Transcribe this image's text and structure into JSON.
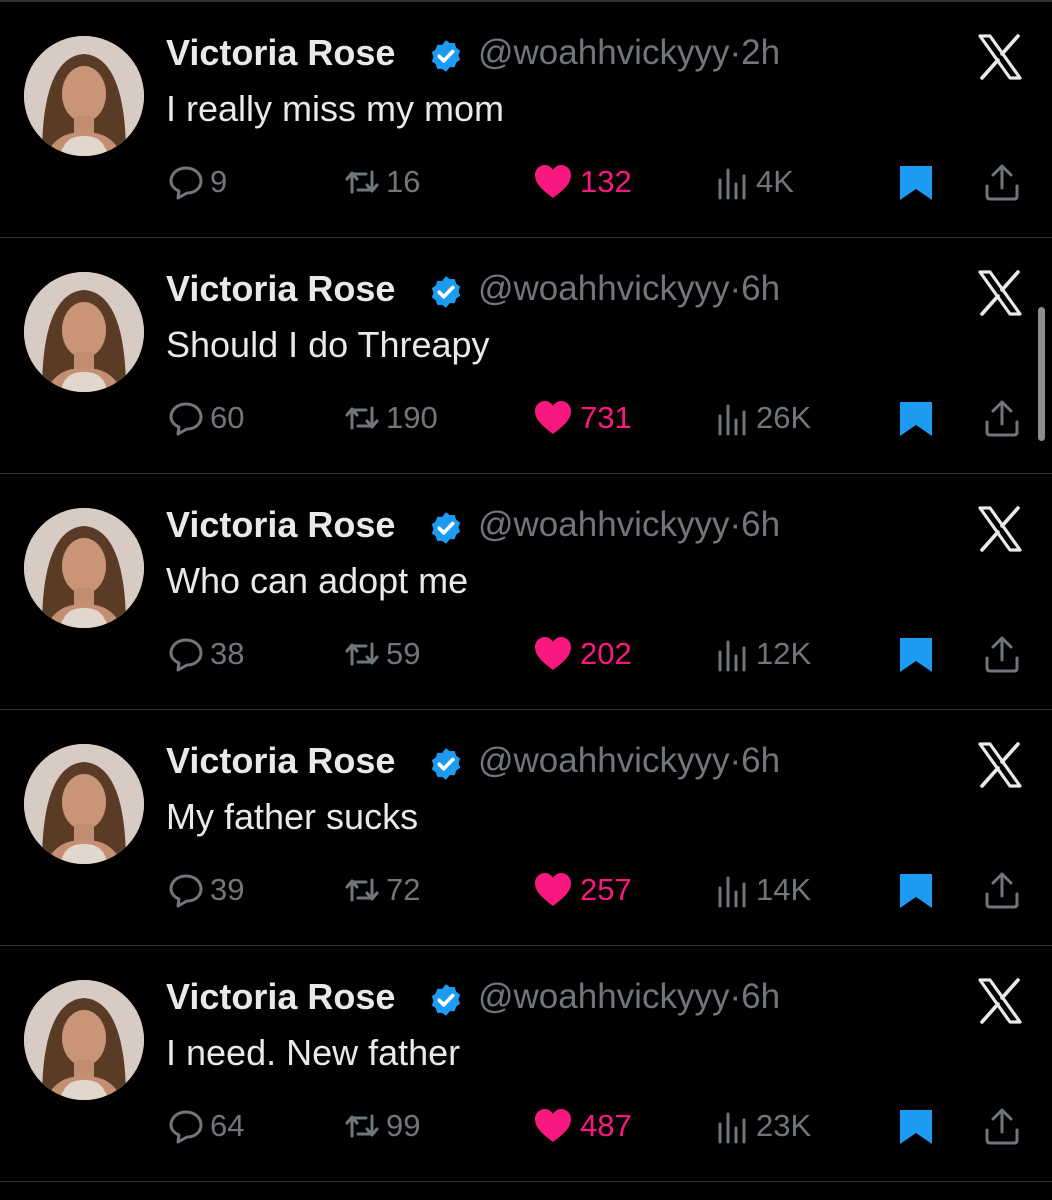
{
  "colors": {
    "background": "#000000",
    "text": "#e7e9ea",
    "muted": "#71767b",
    "like": "#f91880",
    "verified": "#1d9bf0",
    "bookmark": "#1d9bf0",
    "divider": "#2f3336"
  },
  "tweets": [
    {
      "name": "Victoria Rose",
      "handle": "@woahhvickyyy",
      "time": "2h",
      "handle_time": "@woahhvickyyy·2h",
      "text": "I really miss my mom",
      "replies": "9",
      "retweets": "16",
      "likes": "132",
      "views": "4K"
    },
    {
      "name": "Victoria Rose",
      "handle": "@woahhvickyyy",
      "time": "6h",
      "handle_time": "@woahhvickyyy·6h",
      "text": "Should I do Threapy",
      "replies": "60",
      "retweets": "190",
      "likes": "731",
      "views": "26K"
    },
    {
      "name": "Victoria Rose",
      "handle": "@woahhvickyyy",
      "time": "6h",
      "handle_time": "@woahhvickyyy·6h",
      "text": "Who can adopt me",
      "replies": "38",
      "retweets": "59",
      "likes": "202",
      "views": "12K"
    },
    {
      "name": "Victoria Rose",
      "handle": "@woahhvickyyy",
      "time": "6h",
      "handle_time": "@woahhvickyyy·6h",
      "text": "My father sucks",
      "replies": "39",
      "retweets": "72",
      "likes": "257",
      "views": "14K"
    },
    {
      "name": "Victoria Rose",
      "handle": "@woahhvickyyy",
      "time": "6h",
      "handle_time": "@woahhvickyyy·6h",
      "text": "I need. New father",
      "replies": "64",
      "retweets": "99",
      "likes": "487",
      "views": "23K"
    }
  ],
  "icons": {
    "avatar": "profile-photo",
    "verified": "verified-badge-icon",
    "close": "x-logo-icon",
    "reply": "reply-icon",
    "retweet": "retweet-icon",
    "like": "heart-icon",
    "views": "views-icon",
    "bookmark": "bookmark-icon",
    "share": "share-icon"
  }
}
